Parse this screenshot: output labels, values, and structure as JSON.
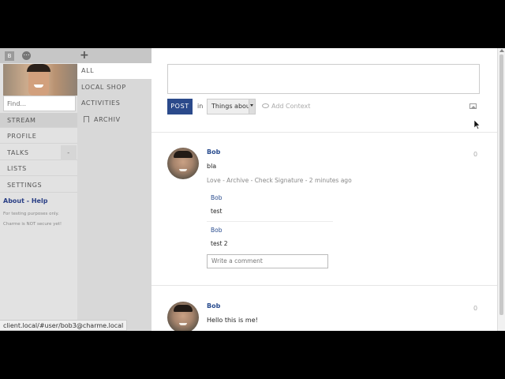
{
  "topbar": {
    "user_badge": "B",
    "menu_glyph": "⋯",
    "add_glyph": "+"
  },
  "sidebar": {
    "find_placeholder": "Find...",
    "items": [
      {
        "label": "STREAM",
        "active": true
      },
      {
        "label": "PROFILE",
        "active": false
      },
      {
        "label": "TALKS",
        "active": false,
        "extra": "-"
      },
      {
        "label": "LISTS",
        "active": false
      },
      {
        "label": "SETTINGS",
        "active": false
      }
    ],
    "about_help": "About - Help",
    "note_line1": "For testing purposes only.",
    "note_line2": "Charme is NOT secure yet!"
  },
  "context_nav": {
    "items": [
      {
        "label": "ALL",
        "active": true
      },
      {
        "label": "LOCAL SHOP",
        "active": false
      },
      {
        "label": "ACTIVITIES",
        "active": false
      },
      {
        "label": "ARCHIV",
        "active": false,
        "icon": "bookmark-icon"
      }
    ]
  },
  "composer": {
    "post_label": "POST",
    "in_label": "in",
    "context_value": "Things abou",
    "add_context_label": "Add Context",
    "image_icon": "image-icon"
  },
  "posts": [
    {
      "author": "Bob",
      "count": "0",
      "text": "bla",
      "meta": "Love - Archive - Check Signature - 2 minutes ago",
      "comments": [
        {
          "author": "Bob",
          "text": "test"
        },
        {
          "author": "Bob",
          "text": "test 2"
        }
      ],
      "comment_placeholder": "Write a comment"
    },
    {
      "author": "Bob",
      "count": "0",
      "text": "Hello this is me!"
    }
  ],
  "statusbar": {
    "url": "client.local/#user/bob3@charme.local"
  },
  "colors": {
    "accent": "#2b4a8b",
    "link": "#2a4d8f",
    "sidebar_bg": "#e2e2e2",
    "context_bg": "#d8d8d8"
  }
}
